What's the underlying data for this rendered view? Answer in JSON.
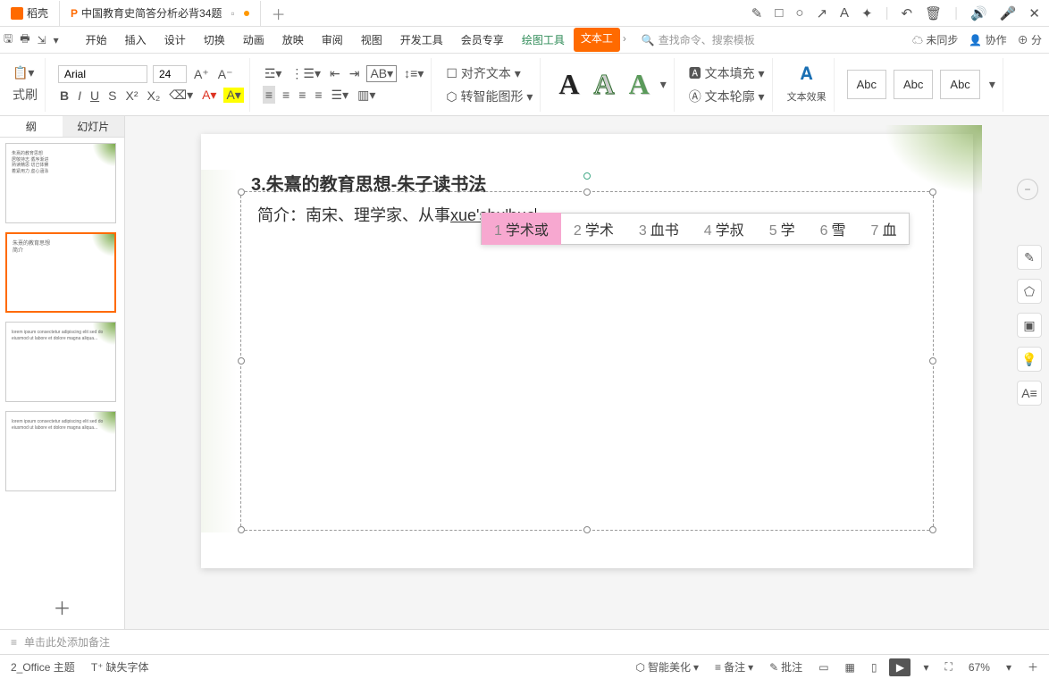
{
  "tabs": {
    "t1": "稻壳",
    "t2": "中国教育史简答分析必背34题"
  },
  "titlebar_icons": [
    "✎",
    "□",
    "○",
    "↗",
    "A",
    "✦",
    "|",
    "↶",
    "🗑",
    "|",
    "🔊",
    "🎤",
    "✕"
  ],
  "menubar": {
    "items": [
      "开始",
      "插入",
      "设计",
      "切换",
      "动画",
      "放映",
      "审阅",
      "视图",
      "开发工具",
      "会员专享"
    ],
    "drawing": "绘图工具",
    "texttool": "文本工",
    "search_placeholder": "查找命令、搜索模板",
    "unsync": "未同步",
    "collab": "协作",
    "share": "分"
  },
  "ribbon": {
    "brush": "式刷",
    "font": "Arial",
    "size": "24",
    "align_text": "对齐文本",
    "smart_shape": "转智能图形",
    "text_fill": "文本填充",
    "text_outline": "文本轮廓",
    "text_effect": "文本效果",
    "abc": "Abc"
  },
  "sidebar": {
    "tab1": "纲",
    "tab2": "幻灯片"
  },
  "slide": {
    "title": "3.朱熹的教育思想-朱子读书法",
    "content_prefix": "简介：南宋、理学家、从事",
    "ime_input": "xue'shu'huo"
  },
  "ime": {
    "candidates": [
      {
        "n": "1",
        "t": "学术或"
      },
      {
        "n": "2",
        "t": "学术"
      },
      {
        "n": "3",
        "t": "血书"
      },
      {
        "n": "4",
        "t": "学叔"
      },
      {
        "n": "5",
        "t": "学"
      },
      {
        "n": "6",
        "t": "雪"
      },
      {
        "n": "7",
        "t": "血"
      }
    ]
  },
  "notes": {
    "placeholder": "单击此处添加备注"
  },
  "statusbar": {
    "theme": "2_Office 主题",
    "missing_font": "缺失字体",
    "smart_beautify": "智能美化",
    "notes_btn": "备注",
    "comments_btn": "批注",
    "zoom": "67%"
  }
}
